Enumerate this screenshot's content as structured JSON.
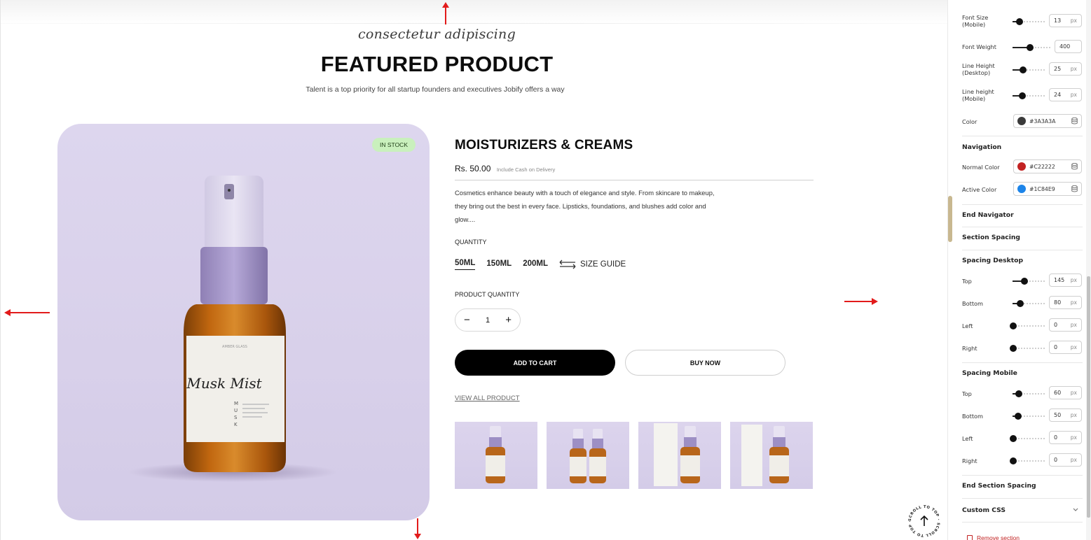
{
  "preview": {
    "subheading": "consectetur adipiscing",
    "heading": "FEATURED PRODUCT",
    "tagline": "Talent is a top priority for all startup founders and executives Jobify offers a way",
    "stock_badge": "IN STOCK",
    "product": {
      "title": "MOISTURIZERS & CREAMS",
      "price": "Rs. 50.00",
      "price_note": "Include Cash on Delivery",
      "description_lines": [
        "Cosmetics enhance beauty with a touch of elegance and style. From skincare to makeup,",
        "they bring out the best in every face. Lipsticks, foundations, and blushes add color and",
        "glow...."
      ],
      "quantity_label": "QUANTITY",
      "sizes": [
        "50ML",
        "150ML",
        "200ML"
      ],
      "selected_size": "50ML",
      "size_guide": "SIZE GUIDE",
      "product_quantity_label": "PRODUCT QUANTITY",
      "quantity_value": "1",
      "minus": "−",
      "plus": "+",
      "add_to_cart": "ADD TO CART",
      "buy_now": "BUY NOW",
      "view_all": "VIEW ALL PRODUCT",
      "bottle_label": "Musk Mist",
      "bottle_side_text": "MUSK"
    },
    "scroll_top_text": "SCROLL TO TOP · SCROLL TO TOP ·"
  },
  "panel": {
    "rows": {
      "font_size_mobile": {
        "label_1": "Font Size",
        "label_2": "(Mobile)",
        "value": "13",
        "unit": "px",
        "level": 0.2
      },
      "font_weight": {
        "label_1": "Font Weight",
        "label_2": "",
        "value": "400",
        "level": 0.45
      },
      "line_height_desktop": {
        "label_1": "Line Height",
        "label_2": "(Desktop)",
        "value": "25",
        "unit": "px",
        "level": 0.3
      },
      "line_height_mobile": {
        "label_1": "Line height",
        "label_2": "(Mobile)",
        "value": "24",
        "unit": "px",
        "level": 0.28
      },
      "color": {
        "label_1": "Color",
        "value": "#3A3A3A",
        "swatch": "#3A3A3A"
      }
    },
    "navigation": {
      "heading": "Navigation",
      "normal_label": "Normal Color",
      "normal_value": "#C22222",
      "normal_swatch": "#C22222",
      "active_label": "Active Color",
      "active_value": "#1C84E9",
      "active_swatch": "#1C84E9"
    },
    "end_navigator": "End Navigator",
    "section_spacing": "Section Spacing",
    "spacing_desktop": {
      "heading": "Spacing Desktop",
      "top": {
        "label": "Top",
        "value": "145",
        "unit": "px",
        "level": 0.35
      },
      "bottom": {
        "label": "Bottom",
        "value": "80",
        "unit": "px",
        "level": 0.22
      },
      "left": {
        "label": "Left",
        "value": "0",
        "unit": "px",
        "level": 0
      },
      "right": {
        "label": "Right",
        "value": "0",
        "unit": "px",
        "level": 0
      }
    },
    "spacing_mobile": {
      "heading": "Spacing Mobile",
      "top": {
        "label": "Top",
        "value": "60",
        "unit": "px",
        "level": 0.17
      },
      "bottom": {
        "label": "Bottom",
        "value": "50",
        "unit": "px",
        "level": 0.15
      },
      "left": {
        "label": "Left",
        "value": "0",
        "unit": "px",
        "level": 0
      },
      "right": {
        "label": "Right",
        "value": "0",
        "unit": "px",
        "level": 0
      }
    },
    "end_section_spacing": "End Section Spacing",
    "custom_css": "Custom CSS",
    "remove_section": "Remove section"
  },
  "colors": {
    "accent_red": "#C22222",
    "accent_blue": "#1C84E9",
    "text_color": "#3A3A3A",
    "stock_badge_bg": "#C9F0BD",
    "hero_bg": "#DDD6EE"
  }
}
